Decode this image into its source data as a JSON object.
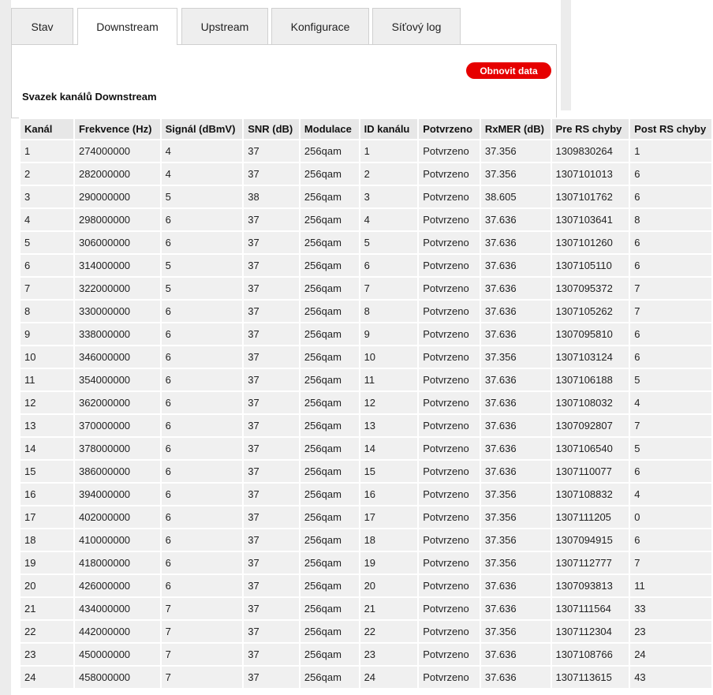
{
  "tabs": [
    {
      "label": "Stav",
      "active": false
    },
    {
      "label": "Downstream",
      "active": true
    },
    {
      "label": "Upstream",
      "active": false
    },
    {
      "label": "Konfigurace",
      "active": false
    },
    {
      "label": "Síťový log",
      "active": false
    }
  ],
  "refresh_label": "Obnovit data",
  "section_title": "Svazek kanálů Downstream",
  "accent_color": "#e60000",
  "table": {
    "headers": [
      "Kanál",
      "Frekvence (Hz)",
      "Signál (dBmV)",
      "SNR (dB)",
      "Modulace",
      "ID kanálu",
      "Potvrzeno",
      "RxMER (dB)",
      "Pre RS chyby",
      "Post RS chyby"
    ],
    "rows": [
      [
        "1",
        "274000000",
        "4",
        "37",
        "256qam",
        "1",
        "Potvrzeno",
        "37.356",
        "1309830264",
        "1"
      ],
      [
        "2",
        "282000000",
        "4",
        "37",
        "256qam",
        "2",
        "Potvrzeno",
        "37.356",
        "1307101013",
        "6"
      ],
      [
        "3",
        "290000000",
        "5",
        "38",
        "256qam",
        "3",
        "Potvrzeno",
        "38.605",
        "1307101762",
        "6"
      ],
      [
        "4",
        "298000000",
        "6",
        "37",
        "256qam",
        "4",
        "Potvrzeno",
        "37.636",
        "1307103641",
        "8"
      ],
      [
        "5",
        "306000000",
        "6",
        "37",
        "256qam",
        "5",
        "Potvrzeno",
        "37.636",
        "1307101260",
        "6"
      ],
      [
        "6",
        "314000000",
        "5",
        "37",
        "256qam",
        "6",
        "Potvrzeno",
        "37.636",
        "1307105110",
        "6"
      ],
      [
        "7",
        "322000000",
        "5",
        "37",
        "256qam",
        "7",
        "Potvrzeno",
        "37.636",
        "1307095372",
        "7"
      ],
      [
        "8",
        "330000000",
        "6",
        "37",
        "256qam",
        "8",
        "Potvrzeno",
        "37.636",
        "1307105262",
        "7"
      ],
      [
        "9",
        "338000000",
        "6",
        "37",
        "256qam",
        "9",
        "Potvrzeno",
        "37.636",
        "1307095810",
        "6"
      ],
      [
        "10",
        "346000000",
        "6",
        "37",
        "256qam",
        "10",
        "Potvrzeno",
        "37.356",
        "1307103124",
        "6"
      ],
      [
        "11",
        "354000000",
        "6",
        "37",
        "256qam",
        "11",
        "Potvrzeno",
        "37.636",
        "1307106188",
        "5"
      ],
      [
        "12",
        "362000000",
        "6",
        "37",
        "256qam",
        "12",
        "Potvrzeno",
        "37.636",
        "1307108032",
        "4"
      ],
      [
        "13",
        "370000000",
        "6",
        "37",
        "256qam",
        "13",
        "Potvrzeno",
        "37.636",
        "1307092807",
        "7"
      ],
      [
        "14",
        "378000000",
        "6",
        "37",
        "256qam",
        "14",
        "Potvrzeno",
        "37.636",
        "1307106540",
        "5"
      ],
      [
        "15",
        "386000000",
        "6",
        "37",
        "256qam",
        "15",
        "Potvrzeno",
        "37.636",
        "1307110077",
        "6"
      ],
      [
        "16",
        "394000000",
        "6",
        "37",
        "256qam",
        "16",
        "Potvrzeno",
        "37.356",
        "1307108832",
        "4"
      ],
      [
        "17",
        "402000000",
        "6",
        "37",
        "256qam",
        "17",
        "Potvrzeno",
        "37.356",
        "1307111205",
        "0"
      ],
      [
        "18",
        "410000000",
        "6",
        "37",
        "256qam",
        "18",
        "Potvrzeno",
        "37.356",
        "1307094915",
        "6"
      ],
      [
        "19",
        "418000000",
        "6",
        "37",
        "256qam",
        "19",
        "Potvrzeno",
        "37.356",
        "1307112777",
        "7"
      ],
      [
        "20",
        "426000000",
        "6",
        "37",
        "256qam",
        "20",
        "Potvrzeno",
        "37.636",
        "1307093813",
        "11"
      ],
      [
        "21",
        "434000000",
        "7",
        "37",
        "256qam",
        "21",
        "Potvrzeno",
        "37.636",
        "1307111564",
        "33"
      ],
      [
        "22",
        "442000000",
        "7",
        "37",
        "256qam",
        "22",
        "Potvrzeno",
        "37.356",
        "1307112304",
        "23"
      ],
      [
        "23",
        "450000000",
        "7",
        "37",
        "256qam",
        "23",
        "Potvrzeno",
        "37.636",
        "1307108766",
        "24"
      ],
      [
        "24",
        "458000000",
        "7",
        "37",
        "256qam",
        "24",
        "Potvrzeno",
        "37.636",
        "1307113615",
        "43"
      ]
    ]
  }
}
